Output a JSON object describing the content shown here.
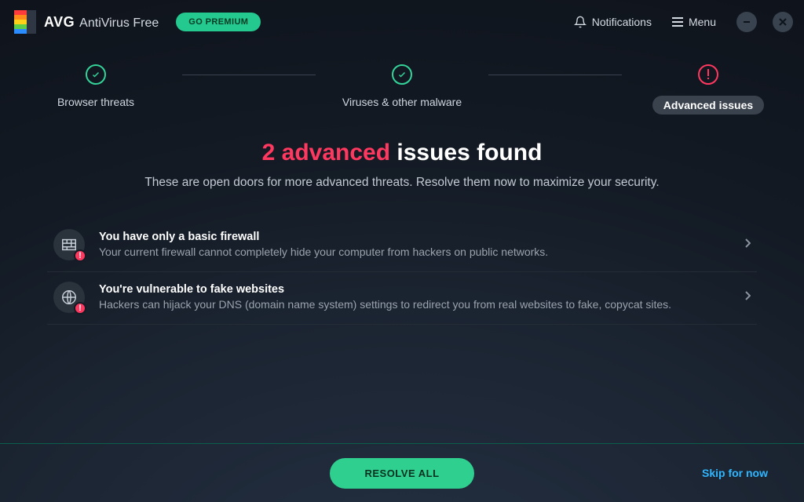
{
  "titlebar": {
    "brand_avg": "AVG",
    "brand_sub": "AntiVirus Free",
    "go_premium": "GO PREMIUM",
    "notifications": "Notifications",
    "menu": "Menu"
  },
  "steps": [
    {
      "label": "Browser threats",
      "state": "done"
    },
    {
      "label": "Viruses & other malware",
      "state": "done"
    },
    {
      "label": "Advanced issues",
      "state": "warn"
    }
  ],
  "headline": {
    "accent": "2 advanced",
    "rest": " issues found",
    "sub": "These are open doors for more advanced threats. Resolve them now to maximize your security."
  },
  "issues": [
    {
      "icon": "firewall-icon",
      "title": "You have only a basic firewall",
      "desc": "Your current firewall cannot completely hide your computer from hackers on public networks."
    },
    {
      "icon": "globe-icon",
      "title": "You're vulnerable to fake websites",
      "desc": "Hackers can hijack your DNS (domain name system) settings to redirect you from real websites to fake, copycat sites."
    }
  ],
  "footer": {
    "resolve": "RESOLVE ALL",
    "skip": "Skip for now"
  }
}
